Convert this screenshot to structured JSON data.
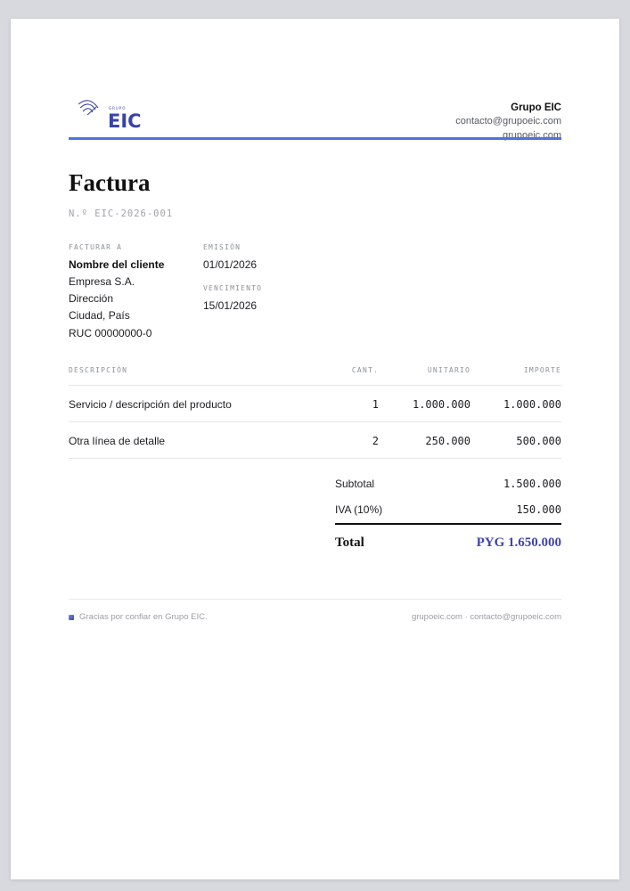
{
  "logo": {
    "small_text": "GRUPO",
    "mark": "EIC"
  },
  "company": {
    "name": "Grupo EIC",
    "email": "contacto@grupoeic.com",
    "web": "grupoeic.com"
  },
  "invoice": {
    "title": "Factura",
    "number": "N.º EIC-2026-001"
  },
  "bill_to": {
    "label": "FACTURAR A",
    "name": "Nombre del cliente",
    "company": "Empresa S.A.",
    "address": "Dirección",
    "city": "Ciudad, País",
    "tax_id": "RUC 00000000-0"
  },
  "dates": {
    "issue_label": "EMISIÓN",
    "issue": "01/01/2026",
    "due_label": "VENCIMIENTO",
    "due": "15/01/2026"
  },
  "table": {
    "headers": {
      "desc": "DESCRIPCIÓN",
      "qty": "CANT.",
      "unit": "UNITARIO",
      "amount": "IMPORTE"
    },
    "rows": [
      {
        "desc": "Servicio / descripción del producto",
        "qty": "1",
        "unit": "1.000.000",
        "amount": "1.000.000"
      },
      {
        "desc": "Otra línea de detalle",
        "qty": "2",
        "unit": "250.000",
        "amount": "500.000"
      }
    ]
  },
  "totals": {
    "subtotal_label": "Subtotal",
    "subtotal": "1.500.000",
    "tax_label": "IVA (10%)",
    "tax": "150.000",
    "total_label": "Total",
    "total": "PYG 1.650.000"
  },
  "footer": {
    "thanks": "Gracias por confiar en Grupo EIC.",
    "contact": "grupoeic.com · contacto@grupoeic.com"
  },
  "colors": {
    "accent": "#4c72e3",
    "brand": "#3f46a8"
  }
}
